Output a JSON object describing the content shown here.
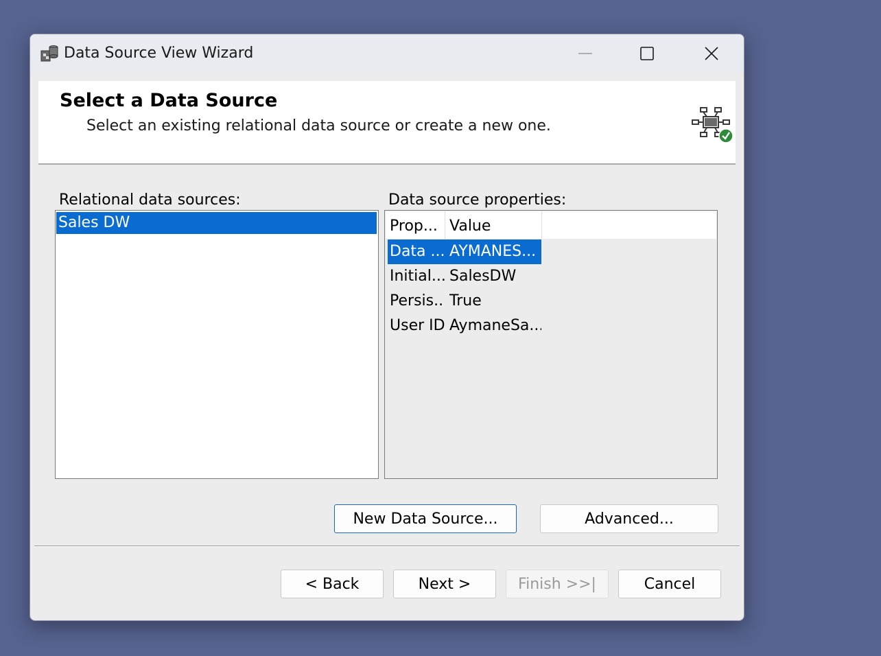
{
  "window": {
    "title": "Data Source View Wizard",
    "app_icon": "data-source-view-icon",
    "controls": {
      "minimize": "minimize-icon",
      "maximize": "maximize-icon",
      "close": "close-icon"
    }
  },
  "header": {
    "title": "Select a Data Source",
    "subtitle": "Select an existing relational data source or create a new one.",
    "icon": "data-source-network-check-icon"
  },
  "sources": {
    "label": "Relational data sources:",
    "items": [
      {
        "label": "Sales DW",
        "selected": true
      }
    ]
  },
  "properties": {
    "label": "Data source properties:",
    "columns": [
      "Prop...",
      "Value"
    ],
    "rows": [
      {
        "key": "Data ...",
        "value": "AYMANES...",
        "selected": true
      },
      {
        "key": "Initial...",
        "value": "SalesDW",
        "selected": false
      },
      {
        "key": "Persis...",
        "value": "True",
        "selected": false
      },
      {
        "key": "User ID",
        "value": "AymaneSa...",
        "selected": false
      }
    ]
  },
  "buttons": {
    "new_data_source": "New Data Source...",
    "advanced": "Advanced...",
    "back": "< Back",
    "next": "Next >",
    "finish": "Finish >>|",
    "cancel": "Cancel"
  },
  "colors": {
    "selection": "#0a6cd1",
    "success_badge": "#2e8b3a",
    "desktop": "#56628f"
  }
}
